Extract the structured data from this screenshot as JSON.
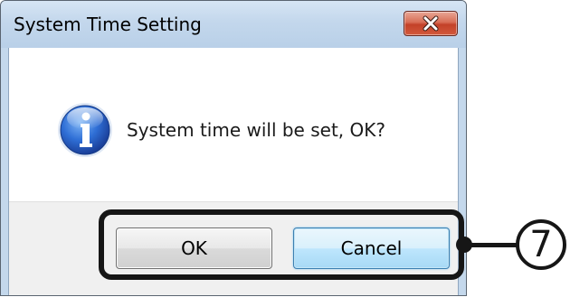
{
  "dialog": {
    "title": "System Time Setting",
    "close_icon": "close-x-icon",
    "message_icon": "information-icon",
    "message": "System time will be set, OK?",
    "ok_label": "OK",
    "cancel_label": "Cancel"
  },
  "annotation": {
    "step_number": "7",
    "icon": "circled-number-seven"
  },
  "colors": {
    "close_button": "#c9472c",
    "dialog_frame": "#c4d8ec",
    "focused_button_border": "#3c7fb1",
    "callout": "#161616"
  }
}
